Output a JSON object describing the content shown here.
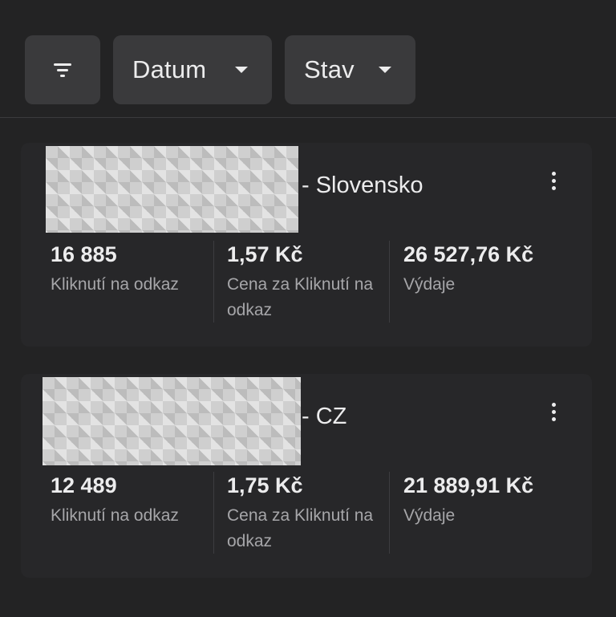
{
  "toolbar": {
    "filter_icon": "filter-icon",
    "date_label": "Datum",
    "status_label": "Stav"
  },
  "campaigns": [
    {
      "name_suffix": "- Slovensko",
      "metrics": [
        {
          "value": "16 885",
          "label": "Kliknutí na odkaz"
        },
        {
          "value": "1,57 Kč",
          "label": "Cena za Kliknutí na odkaz"
        },
        {
          "value": "26 527,76 Kč",
          "label": "Výdaje"
        }
      ]
    },
    {
      "name_suffix": "- CZ",
      "metrics": [
        {
          "value": "12 489",
          "label": "Kliknutí na odkaz"
        },
        {
          "value": "1,75 Kč",
          "label": "Cena za Kliknutí na odkaz"
        },
        {
          "value": "21 889,91 Kč",
          "label": "Výdaje"
        }
      ]
    }
  ],
  "colors": {
    "background": "#232324",
    "button": "#3a3a3c",
    "card": "#272729",
    "text": "#ececed",
    "muted": "#a6a6a9"
  }
}
